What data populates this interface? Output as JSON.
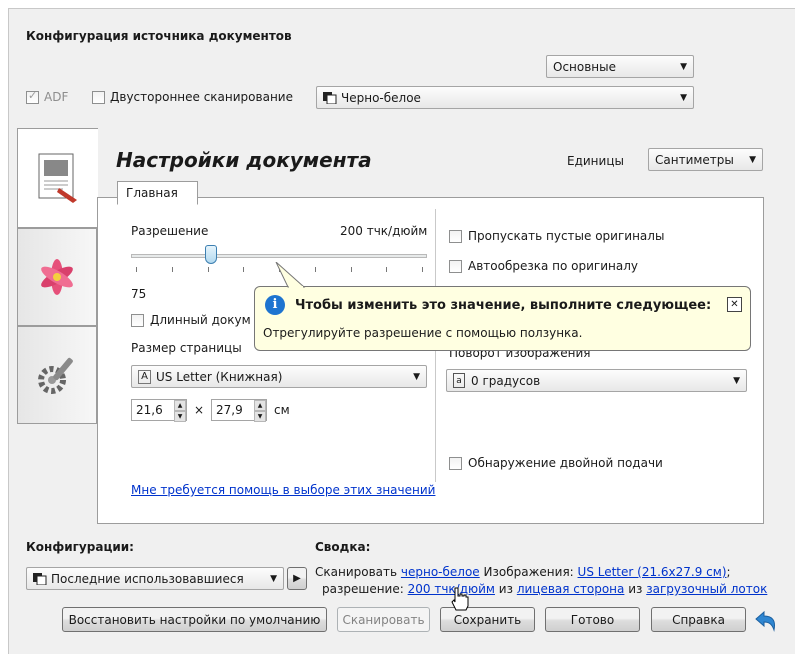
{
  "header": {
    "title": "Конфигурация источника документов",
    "mode_select": "Основные",
    "adf_label": "ADF",
    "duplex_label": "Двустороннее сканирование",
    "color_mode": "Черно-белое"
  },
  "document": {
    "title": "Настройки документа",
    "units_label": "Единицы",
    "units_value": "Сантиметры",
    "tab_main": "Главная"
  },
  "resolution": {
    "label": "Разрешение",
    "value": "200 тчк/дюйм",
    "min_label": "75",
    "slider_fraction": 0.27
  },
  "long_doc_label": "Длинный докум",
  "page_size": {
    "label": "Размер страницы",
    "value": "US Letter (Книжная)",
    "width": "21,6",
    "times": "×",
    "height": "27,9",
    "unit": "см"
  },
  "help_link": "Мне требуется помощь в выборе этих значений",
  "right_options": {
    "skip_blank": "Пропускать пустые оригиналы",
    "autocrop": "Автообрезка по оригиналу",
    "rotation_label": "Поворот изображения",
    "rotation_value": "0 градусов",
    "double_feed": "Обнаружение двойной подачи"
  },
  "tooltip": {
    "title": "Чтобы изменить это значение, выполните следующее:",
    "body": "Отрегулируйте разрешение с помощью ползунка.",
    "close": "✕"
  },
  "configs": {
    "label": "Конфигурации:",
    "value": "Последние использовавшиеся",
    "arrow": "▶"
  },
  "summary": {
    "label": "Сводка:",
    "scan_prefix": "Сканировать",
    "scan_link": "черно-белое",
    "images_prefix": "Изображения:",
    "images_link": "US Letter (21.6x27.9 см)",
    "semicolon": ";",
    "res_prefix": "разрешение:",
    "res_link": "200 тчк/дюйм",
    "from1": "из",
    "side_link": "лицевая сторона",
    "from2": "из",
    "tray_link": "загрузочный лоток"
  },
  "buttons": {
    "restore": "Восстановить настройки по умолчанию",
    "scan": "Сканировать",
    "save": "Сохранить",
    "done": "Готово",
    "help": "Справка"
  },
  "colors": {
    "link": "#0033cc",
    "tooltip_bg": "#ffffe1",
    "info_icon": "#1e74d0"
  }
}
